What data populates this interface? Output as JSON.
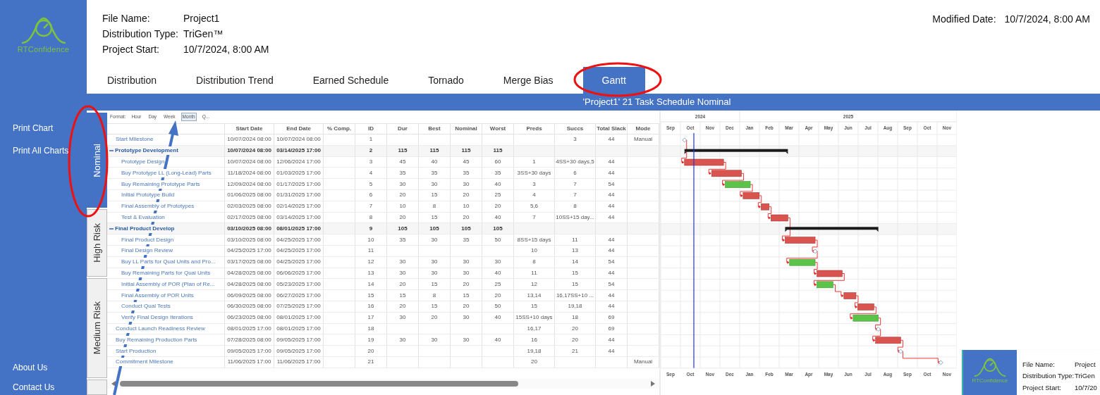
{
  "logo": {
    "text": "RTConfidence"
  },
  "sidebar": {
    "items": [
      {
        "label": "Print Chart"
      },
      {
        "label": "Print All Charts"
      }
    ],
    "bottom_items": [
      {
        "label": "About Us"
      },
      {
        "label": "Contact Us"
      }
    ]
  },
  "header": {
    "fields": [
      {
        "label": "File Name:",
        "value": "Project1"
      },
      {
        "label": "Distribution Type:",
        "value": "TriGen™"
      },
      {
        "label": "Project Start:",
        "value": "10/7/2024, 8:00 AM"
      }
    ],
    "modified": {
      "label": "Modified Date:",
      "value": "10/7/2024, 8:00 AM"
    }
  },
  "tabs": [
    {
      "label": "Distribution",
      "selected": false
    },
    {
      "label": "Distribution Trend",
      "selected": false
    },
    {
      "label": "Earned Schedule",
      "selected": false
    },
    {
      "label": "Tornado",
      "selected": false
    },
    {
      "label": "Merge Bias",
      "selected": false
    },
    {
      "label": "Gantt",
      "selected": true
    }
  ],
  "chart_title": "'Project1' 21 Task Schedule Nominal",
  "risk_tabs": [
    {
      "label": "Nominal",
      "selected": true
    },
    {
      "label": "High Risk",
      "selected": false
    },
    {
      "label": "Medium Risk",
      "selected": false
    }
  ],
  "format": {
    "label": "Format:",
    "options": [
      {
        "label": "Hour",
        "selected": false
      },
      {
        "label": "Day",
        "selected": false
      },
      {
        "label": "Week",
        "selected": false
      },
      {
        "label": "Month",
        "selected": true
      },
      {
        "label": "Q...",
        "selected": false
      }
    ]
  },
  "table": {
    "columns": [
      "Start Date",
      "End Date",
      "% Comp.",
      "ID",
      "Dur",
      "Best",
      "Nominal",
      "Worst",
      "Preds",
      "Succs",
      "Total Slack",
      "Mode"
    ],
    "rows": [
      {
        "kind": "milestone",
        "name": "Start Milestone",
        "start": "10/07/2024 08:00",
        "end": "10/07/2024 08:00",
        "id": "1",
        "succs": "3",
        "slack": "44",
        "mode": "Manual"
      },
      {
        "kind": "summary",
        "expanded": true,
        "name": "Prototype Development",
        "start": "10/07/2024 08:00",
        "end": "03/14/2025 17:00",
        "id": "2",
        "dur": "115",
        "best": "115",
        "nominal": "115",
        "worst": "115",
        "children": [
          {
            "kind": "task",
            "critical": true,
            "name": "Prototype Design",
            "start": "10/07/2024 08:00",
            "end": "12/06/2024 17:00",
            "id": "3",
            "dur": "45",
            "best": "40",
            "nominal": "45",
            "worst": "60",
            "preds": "1",
            "succs": "4SS+30 days,5",
            "slack": "44"
          },
          {
            "kind": "task",
            "critical": true,
            "name": "Buy Prototype LL (Long-Lead) Parts",
            "start": "11/18/2024 08:00",
            "end": "01/03/2025 17:00",
            "id": "4",
            "dur": "35",
            "best": "35",
            "nominal": "35",
            "worst": "35",
            "preds": "3SS+30 days",
            "succs": "6",
            "slack": "44"
          },
          {
            "kind": "task",
            "critical": false,
            "name": "Buy Remaining Prototype Parts",
            "start": "12/09/2024 08:00",
            "end": "01/17/2025 17:00",
            "id": "5",
            "dur": "30",
            "best": "30",
            "nominal": "30",
            "worst": "40",
            "preds": "3",
            "succs": "7",
            "slack": "54"
          },
          {
            "kind": "task",
            "critical": true,
            "name": "Initial Prototype Build",
            "start": "01/06/2025 08:00",
            "end": "01/31/2025 17:00",
            "id": "6",
            "dur": "20",
            "best": "15",
            "nominal": "20",
            "worst": "25",
            "preds": "4",
            "succs": "7",
            "slack": "44"
          },
          {
            "kind": "task",
            "critical": true,
            "name": "Final Assembly of Prototypes",
            "start": "02/03/2025 08:00",
            "end": "02/14/2025 17:00",
            "id": "7",
            "dur": "10",
            "best": "8",
            "nominal": "10",
            "worst": "20",
            "preds": "5,6",
            "succs": "8",
            "slack": "44"
          },
          {
            "kind": "task",
            "critical": true,
            "name": "Test & Evaluation",
            "start": "02/17/2025 08:00",
            "end": "03/14/2025 17:00",
            "id": "8",
            "dur": "20",
            "best": "15",
            "nominal": "20",
            "worst": "40",
            "preds": "7",
            "succs": "10SS+15 day...",
            "slack": "44"
          }
        ]
      },
      {
        "kind": "summary",
        "expanded": true,
        "name": "Final Product Develop",
        "start": "03/10/2025 08:00",
        "end": "08/01/2025 17:00",
        "id": "9",
        "dur": "105",
        "best": "105",
        "nominal": "105",
        "worst": "105",
        "children": [
          {
            "kind": "task",
            "critical": true,
            "name": "Final Product Design",
            "start": "03/10/2025 08:00",
            "end": "04/25/2025 17:00",
            "id": "10",
            "dur": "35",
            "best": "30",
            "nominal": "35",
            "worst": "50",
            "preds": "8SS+15 days",
            "succs": "11",
            "slack": "44"
          },
          {
            "kind": "milestone",
            "name": "Final Design Review",
            "start": "04/25/2025 17:00",
            "end": "04/25/2025 17:00",
            "id": "11",
            "preds": "10",
            "succs": "13",
            "slack": "44"
          },
          {
            "kind": "task",
            "critical": false,
            "name": "Buy LL Parts for Qual Units and Pro...",
            "start": "03/17/2025 08:00",
            "end": "04/25/2025 17:00",
            "id": "12",
            "dur": "30",
            "best": "30",
            "nominal": "30",
            "worst": "30",
            "preds": "8",
            "succs": "14",
            "slack": "54"
          },
          {
            "kind": "task",
            "critical": true,
            "name": "Buy Remaining Parts for Qual Units",
            "start": "04/28/2025 08:00",
            "end": "06/06/2025 17:00",
            "id": "13",
            "dur": "30",
            "best": "30",
            "nominal": "30",
            "worst": "40",
            "preds": "11",
            "succs": "15",
            "slack": "44"
          },
          {
            "kind": "task",
            "critical": false,
            "name": "Initial Assembly of POR (Plan of Re...",
            "start": "04/28/2025 08:00",
            "end": "05/23/2025 17:00",
            "id": "14",
            "dur": "20",
            "best": "15",
            "nominal": "20",
            "worst": "25",
            "preds": "12",
            "succs": "15",
            "slack": "54"
          },
          {
            "kind": "task",
            "critical": true,
            "name": "Final Assembly of POR Units",
            "start": "06/09/2025 08:00",
            "end": "06/27/2025 17:00",
            "id": "15",
            "dur": "15",
            "best": "8",
            "nominal": "15",
            "worst": "20",
            "preds": "13,14",
            "succs": "16,17SS+10 ...",
            "slack": "44"
          },
          {
            "kind": "task",
            "critical": true,
            "name": "Conduct Qual Tests",
            "start": "06/30/2025 08:00",
            "end": "07/25/2025 17:00",
            "id": "16",
            "dur": "20",
            "best": "15",
            "nominal": "20",
            "worst": "50",
            "preds": "15",
            "succs": "19,18",
            "slack": "44"
          },
          {
            "kind": "task",
            "critical": false,
            "name": "Verify Final Design Iterations",
            "start": "06/23/2025 08:00",
            "end": "08/01/2025 17:00",
            "id": "17",
            "dur": "30",
            "best": "20",
            "nominal": "30",
            "worst": "40",
            "preds": "15SS+10 days",
            "succs": "18",
            "slack": "69"
          }
        ]
      },
      {
        "kind": "milestone",
        "name": "Conduct Launch Readiness Review",
        "start": "08/01/2025 17:00",
        "end": "08/01/2025 17:00",
        "id": "18",
        "preds": "16,17",
        "succs": "20",
        "slack": "69"
      },
      {
        "kind": "task",
        "critical": true,
        "name": "Buy Remaining Production Parts",
        "start": "07/28/2025 08:00",
        "end": "09/05/2025 17:00",
        "id": "19",
        "dur": "30",
        "best": "30",
        "nominal": "30",
        "worst": "40",
        "preds": "16",
        "succs": "20",
        "slack": "44"
      },
      {
        "kind": "milestone",
        "name": "Start Production",
        "start": "09/05/2025 17:00",
        "end": "09/05/2025 17:00",
        "id": "20",
        "preds": "19,18",
        "succs": "21",
        "slack": "44"
      },
      {
        "kind": "milestone",
        "name": "Commitment Milestone",
        "start": "11/06/2025 17:00",
        "end": "11/06/2025 17:00",
        "id": "21",
        "preds": "20",
        "mode": "Manual"
      }
    ]
  },
  "gantt": {
    "years": [
      {
        "label": "2024",
        "months": [
          "Sep",
          "Oct",
          "Nov",
          "Dec"
        ]
      },
      {
        "label": "2025",
        "months": [
          "Jan",
          "Feb",
          "Mar",
          "Apr",
          "May",
          "Jun",
          "Jul",
          "Aug",
          "Sep",
          "Oct",
          "Nov"
        ]
      }
    ],
    "bottom_months": [
      "Sep",
      "Oct",
      "Nov",
      "Dec",
      "Jan",
      "Feb",
      "Mar",
      "Apr",
      "May",
      "Jun",
      "Jul",
      "Aug",
      "Sep",
      "Oct",
      "Nov"
    ]
  },
  "popup": {
    "logo_text": "RTConfidence",
    "fields": [
      {
        "label": "File Name:",
        "value": "Project"
      },
      {
        "label": "Distribution Type:",
        "value": "TriGen"
      },
      {
        "label": "Project Start:",
        "value": "10/7/20"
      }
    ]
  }
}
